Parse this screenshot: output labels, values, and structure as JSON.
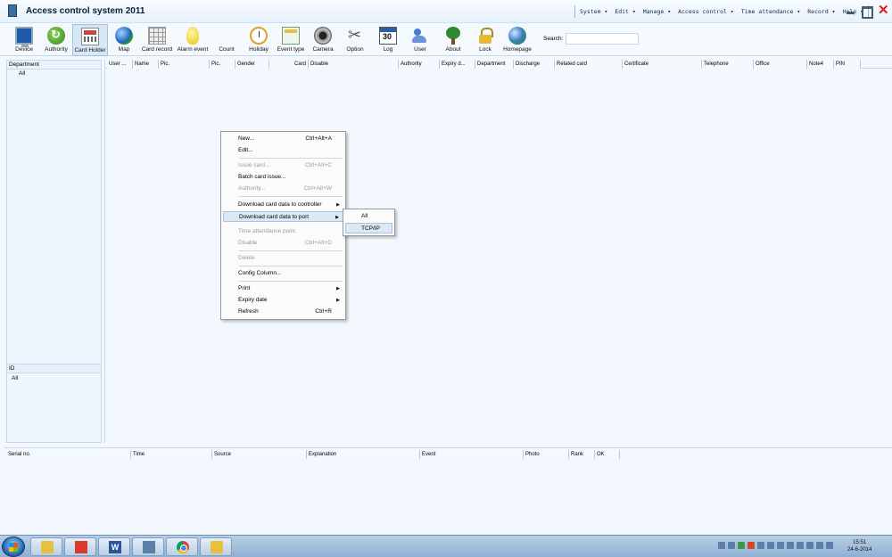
{
  "window": {
    "title": "Access control system 2011",
    "menu": [
      "System ▾",
      "Edit ▾",
      "Manage ▾",
      "Access control ▾",
      "Time attendance ▾",
      "Record ▾",
      "Help ▾"
    ]
  },
  "toolbar": {
    "items": [
      {
        "label": "Device",
        "icon": "monitor-icon"
      },
      {
        "label": "Authority",
        "icon": "refresh-icon"
      },
      {
        "label": "Card Holder",
        "icon": "card-icon",
        "active": true
      },
      {
        "label": "Map",
        "icon": "globe-icon"
      },
      {
        "label": "Card record",
        "icon": "grid-icon"
      },
      {
        "label": "Alarm event",
        "icon": "bulb-icon"
      },
      {
        "label": "Count",
        "icon": "count-icon"
      },
      {
        "label": "Holiday",
        "icon": "clock-icon"
      },
      {
        "label": "Event type",
        "icon": "event-icon"
      },
      {
        "label": "Camera",
        "icon": "camera-icon"
      },
      {
        "label": "Option",
        "icon": "tools-icon"
      },
      {
        "label": "Log",
        "icon": "calendar-icon"
      },
      {
        "label": "User",
        "icon": "user-icon"
      },
      {
        "label": "About",
        "icon": "tree-icon"
      },
      {
        "label": "Lock",
        "icon": "lock-icon"
      },
      {
        "label": "Homepage",
        "icon": "globe-icon"
      }
    ],
    "search_label": "Search:",
    "search_value": ""
  },
  "left_panel": {
    "department_header": "Department",
    "department_items": [
      "All"
    ],
    "id_header": "ID",
    "id_items": [
      "All"
    ]
  },
  "grid": {
    "columns": [
      "User ...",
      "Name",
      "Pic.",
      "Pic.",
      "Gender",
      "Card",
      "Disable",
      "Authority",
      "Expiry d...",
      "Department",
      "Discharge",
      "Related card",
      "Certificate",
      "Telephone",
      "Office",
      "Note4",
      "PIN"
    ]
  },
  "event_log": {
    "columns": [
      "Serial no.",
      "Time",
      "Source",
      "Explanation",
      "Event",
      "Photo",
      "Rank",
      "OK"
    ]
  },
  "context_menu": {
    "items": [
      {
        "label": "New...",
        "shortcut": "Ctrl+Alt+A",
        "disabled": false
      },
      {
        "label": "Edit...",
        "shortcut": "",
        "disabled": false
      },
      {
        "label": "Issue card...",
        "shortcut": "Ctrl+Alt+C",
        "disabled": true
      },
      {
        "label": "Batch card issue...",
        "shortcut": "",
        "disabled": false
      },
      {
        "label": "Authority...",
        "shortcut": "Ctrl+Alt+W",
        "disabled": true
      },
      {
        "label": "Download card data to controller",
        "shortcut": "",
        "disabled": false,
        "submenu": true
      },
      {
        "label": "Download card data to port",
        "shortcut": "",
        "disabled": false,
        "submenu": true,
        "highlighted": true
      },
      {
        "label": "Time attendance point",
        "shortcut": "",
        "disabled": true
      },
      {
        "label": "Disable",
        "shortcut": "Ctrl+Alt+D",
        "disabled": true
      },
      {
        "label": "Delete",
        "shortcut": "",
        "disabled": true
      },
      {
        "label": "Config Column...",
        "shortcut": "",
        "disabled": false
      },
      {
        "label": "Print",
        "shortcut": "",
        "disabled": false,
        "submenu": true
      },
      {
        "label": "Expiry date",
        "shortcut": "",
        "disabled": false,
        "submenu": true
      },
      {
        "label": "Refresh",
        "shortcut": "Ctrl+R",
        "disabled": false
      }
    ],
    "submenu_items": [
      {
        "label": "All",
        "highlighted": false
      },
      {
        "label": "TCP/IP",
        "highlighted": true
      }
    ]
  },
  "taskbar": {
    "apps": [
      "folder-icon",
      "pdf-icon",
      "word-icon",
      "app-icon",
      "chrome-icon",
      "folder-icon"
    ],
    "clock_time": "15:51",
    "clock_date": "24-6-2014"
  },
  "colors": {
    "background": "#f2f8fd",
    "close_button": "#e21c1c",
    "menu_highlight": "#dbe8f5"
  }
}
